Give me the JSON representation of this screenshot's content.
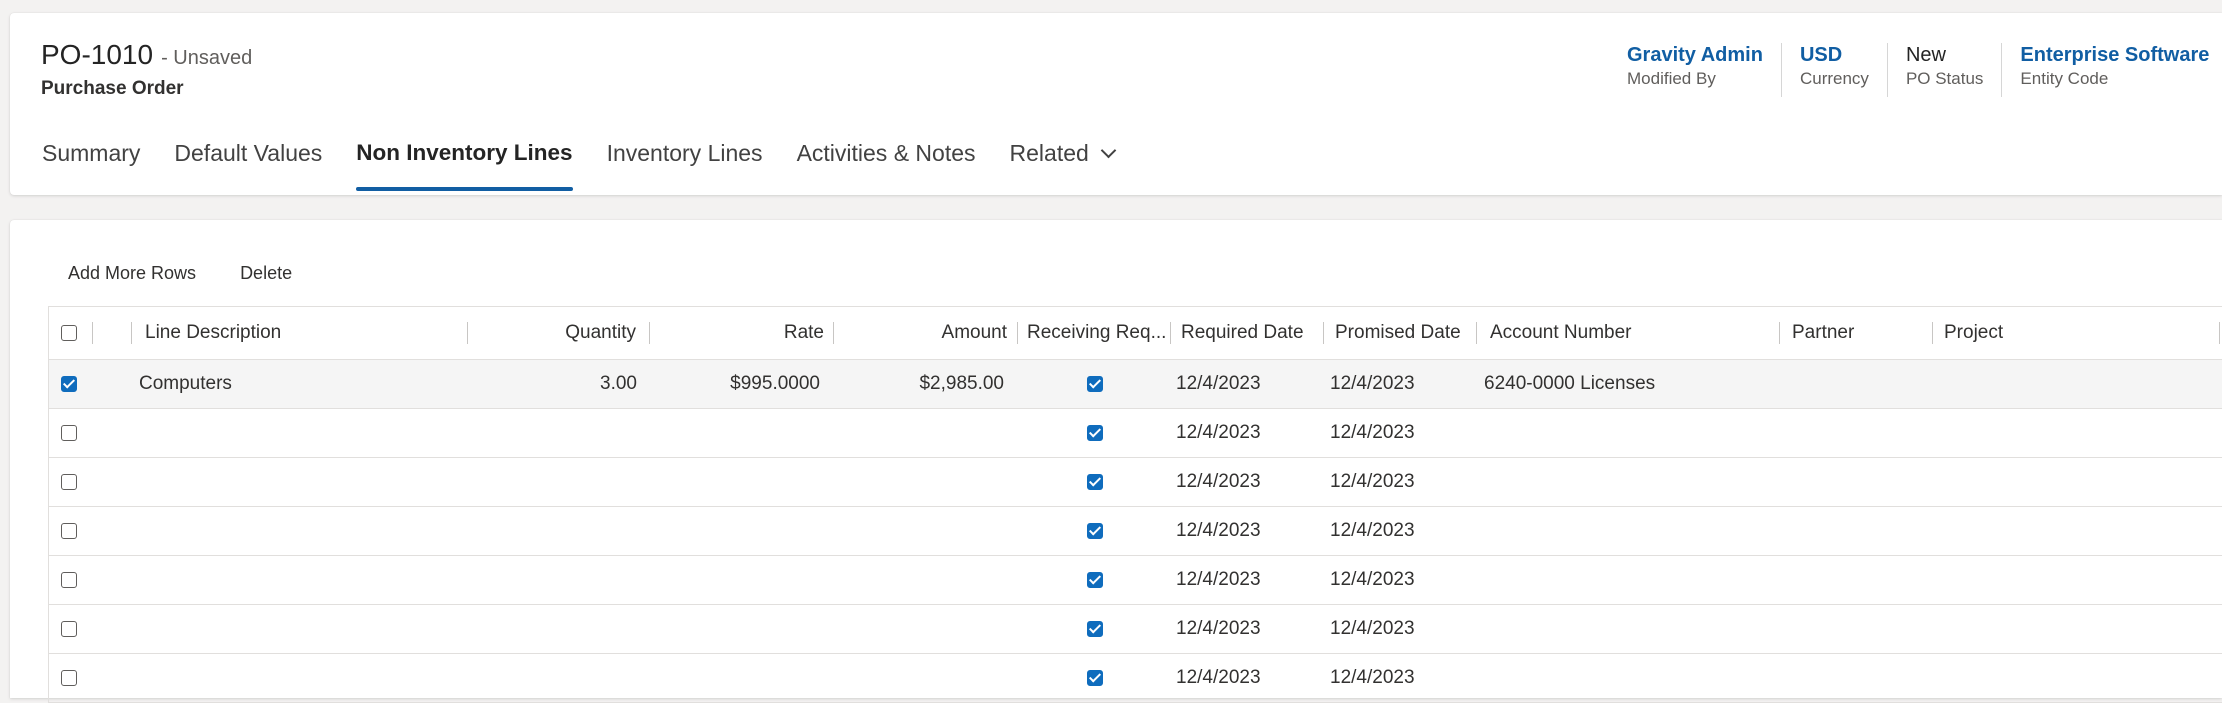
{
  "record": {
    "id": "PO-1010",
    "state": "- Unsaved",
    "entity_type": "Purchase Order"
  },
  "header_fields": [
    {
      "value": "Gravity Admin",
      "label": "Modified By",
      "link": true
    },
    {
      "value": "USD",
      "label": "Currency",
      "link": true
    },
    {
      "value": "New",
      "label": "PO Status",
      "link": false
    },
    {
      "value": "Enterprise Software",
      "label": "Entity Code",
      "link": true
    }
  ],
  "tabs": [
    {
      "label": "Summary"
    },
    {
      "label": "Default Values"
    },
    {
      "label": "Non Inventory Lines",
      "active": true
    },
    {
      "label": "Inventory Lines"
    },
    {
      "label": "Activities & Notes"
    },
    {
      "label": "Related",
      "dropdown": true
    }
  ],
  "toolbar": {
    "add_rows_label": "Add More Rows",
    "delete_label": "Delete"
  },
  "grid": {
    "columns": {
      "line_description": "Line Description",
      "quantity": "Quantity",
      "rate": "Rate",
      "amount": "Amount",
      "receiving_required": "Receiving Req...",
      "required_date": "Required Date",
      "promised_date": "Promised Date",
      "account_number": "Account Number",
      "partner": "Partner",
      "project": "Project"
    },
    "header_checkbox_checked": false,
    "rows": [
      {
        "selected": true,
        "line_description": "Computers",
        "quantity": "3.00",
        "rate": "$995.0000",
        "amount": "$2,985.00",
        "receiving_required": true,
        "required_date": "12/4/2023",
        "promised_date": "12/4/2023",
        "account_number": "6240-0000 Licenses",
        "partner": "",
        "project": ""
      },
      {
        "selected": false,
        "line_description": "",
        "quantity": "",
        "rate": "",
        "amount": "",
        "receiving_required": true,
        "required_date": "12/4/2023",
        "promised_date": "12/4/2023",
        "account_number": "",
        "partner": "",
        "project": ""
      },
      {
        "selected": false,
        "line_description": "",
        "quantity": "",
        "rate": "",
        "amount": "",
        "receiving_required": true,
        "required_date": "12/4/2023",
        "promised_date": "12/4/2023",
        "account_number": "",
        "partner": "",
        "project": ""
      },
      {
        "selected": false,
        "line_description": "",
        "quantity": "",
        "rate": "",
        "amount": "",
        "receiving_required": true,
        "required_date": "12/4/2023",
        "promised_date": "12/4/2023",
        "account_number": "",
        "partner": "",
        "project": ""
      },
      {
        "selected": false,
        "line_description": "",
        "quantity": "",
        "rate": "",
        "amount": "",
        "receiving_required": true,
        "required_date": "12/4/2023",
        "promised_date": "12/4/2023",
        "account_number": "",
        "partner": "",
        "project": ""
      },
      {
        "selected": false,
        "line_description": "",
        "quantity": "",
        "rate": "",
        "amount": "",
        "receiving_required": true,
        "required_date": "12/4/2023",
        "promised_date": "12/4/2023",
        "account_number": "",
        "partner": "",
        "project": ""
      },
      {
        "selected": false,
        "line_description": "",
        "quantity": "",
        "rate": "",
        "amount": "",
        "receiving_required": true,
        "required_date": "12/4/2023",
        "promised_date": "12/4/2023",
        "account_number": "",
        "partner": "",
        "project": ""
      }
    ]
  },
  "colors": {
    "accent": "#115ea3",
    "checkbox_checked": "#0f6cbd"
  }
}
